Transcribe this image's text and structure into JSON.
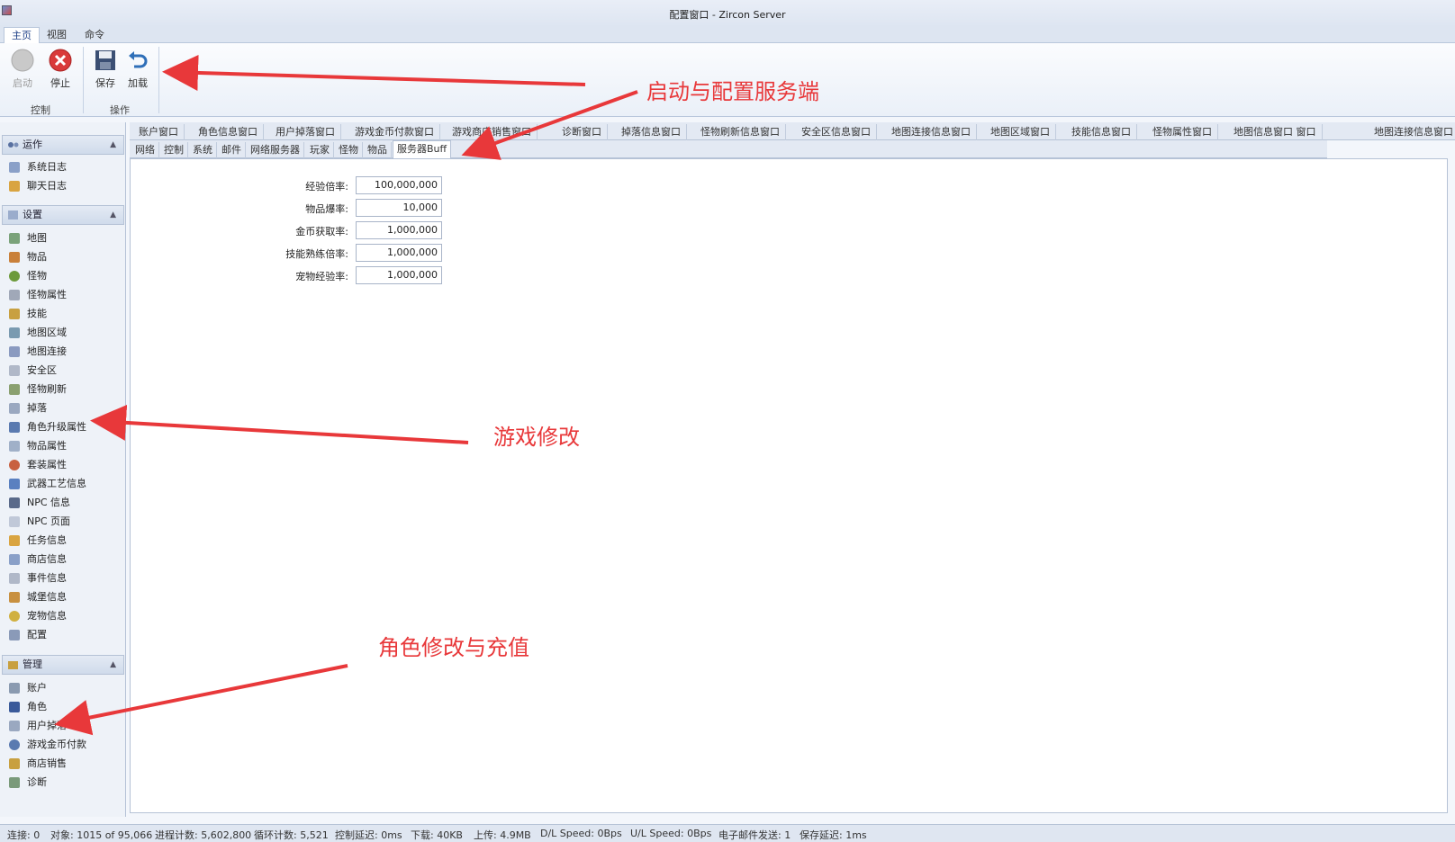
{
  "window": {
    "title": "配置窗口 - Zircon Server"
  },
  "menu_tabs": [
    "主页",
    "视图",
    "命令"
  ],
  "ribbon": {
    "buttons": [
      {
        "label": "启动",
        "icon": "start-icon"
      },
      {
        "label": "停止",
        "icon": "stop-icon"
      },
      {
        "label": "保存",
        "icon": "save-icon"
      },
      {
        "label": "加载",
        "icon": "reload-icon"
      }
    ],
    "groups": [
      "控制",
      "操作"
    ]
  },
  "sidebar": {
    "groups": [
      {
        "label": "运作",
        "items": [
          "系统日志",
          "聊天日志"
        ]
      },
      {
        "label": "设置",
        "items": [
          "地图",
          "物品",
          "怪物",
          "怪物属性",
          "技能",
          "地图区域",
          "地图连接",
          "安全区",
          "怪物刷新",
          "掉落",
          "角色升级属性",
          "物品属性",
          "套装属性",
          "武器工艺信息",
          "NPC 信息",
          "NPC 页面",
          "任务信息",
          "商店信息",
          "事件信息",
          "城堡信息",
          "宠物信息",
          "配置"
        ]
      },
      {
        "label": "管理",
        "items": [
          "账户",
          "角色",
          "用户掉落",
          "游戏金币付款",
          "商店销售",
          "诊断"
        ]
      }
    ]
  },
  "doc_tabs": [
    "账户窗口",
    "角色信息窗口",
    "用户掉落窗口",
    "游戏金币付款窗口",
    "游戏商店销售窗口",
    "诊断窗口",
    "掉落信息窗口",
    "怪物刷新信息窗口",
    "安全区信息窗口",
    "地图连接信息窗口",
    "地图区域窗口",
    "技能信息窗口",
    "怪物属性窗口",
    "地图信息窗口 窗口",
    "地图连接信息窗口"
  ],
  "config_tabs": {
    "items": [
      "网络",
      "控制",
      "系统",
      "邮件",
      "网络服务器",
      "玩家",
      "怪物",
      "物品",
      "服务器Buff"
    ],
    "active": "服务器Buff"
  },
  "form": {
    "fields": [
      {
        "label": "经验倍率:",
        "value": "100,000,000"
      },
      {
        "label": "物品爆率:",
        "value": "10,000"
      },
      {
        "label": "金币获取率:",
        "value": "1,000,000"
      },
      {
        "label": "技能熟练倍率:",
        "value": "1,000,000"
      },
      {
        "label": "宠物经验率:",
        "value": "1,000,000"
      }
    ]
  },
  "status": [
    "连接: 0",
    "对象: 1015 of 95,066",
    "进程计数: 5,602,800",
    "循环计数: 5,521",
    "控制延迟: 0ms",
    "下载: 40KB",
    "上传: 4.9MB",
    "D/L Speed: 0Bps",
    "U/L Speed: 0Bps",
    "电子邮件发送: 1",
    "保存延迟: 1ms"
  ],
  "annotations": [
    "启动与配置服务端",
    "游戏修改",
    "角色修改与充值"
  ],
  "colors": {
    "annotation": "#e8383a",
    "accent": "#1c3e86"
  }
}
